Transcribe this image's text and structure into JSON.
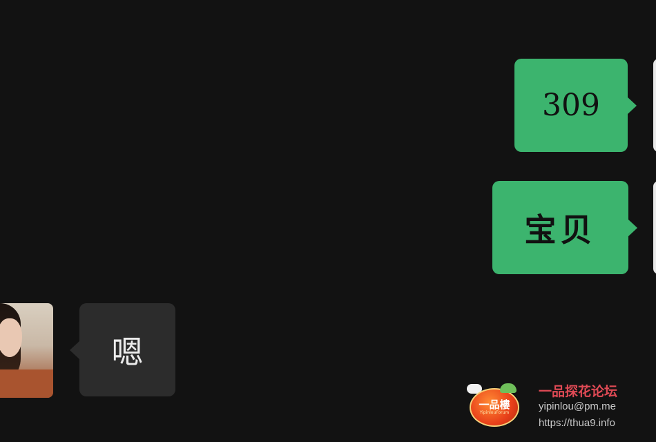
{
  "messages": [
    {
      "direction": "outgoing",
      "text": "309"
    },
    {
      "direction": "outgoing",
      "text": "宝贝"
    },
    {
      "direction": "incoming",
      "text": "嗯"
    }
  ],
  "watermark": {
    "logo_text": "一品樓",
    "logo_subtext": "YipinlouForum",
    "title": "一品探花论坛",
    "email": "yipinlou@pm.me",
    "url": "https://thua9.info"
  },
  "colors": {
    "background": "#121212",
    "outgoing_bubble": "#3cb46e",
    "incoming_bubble": "#2c2c2c",
    "watermark_title": "#e04a55"
  }
}
